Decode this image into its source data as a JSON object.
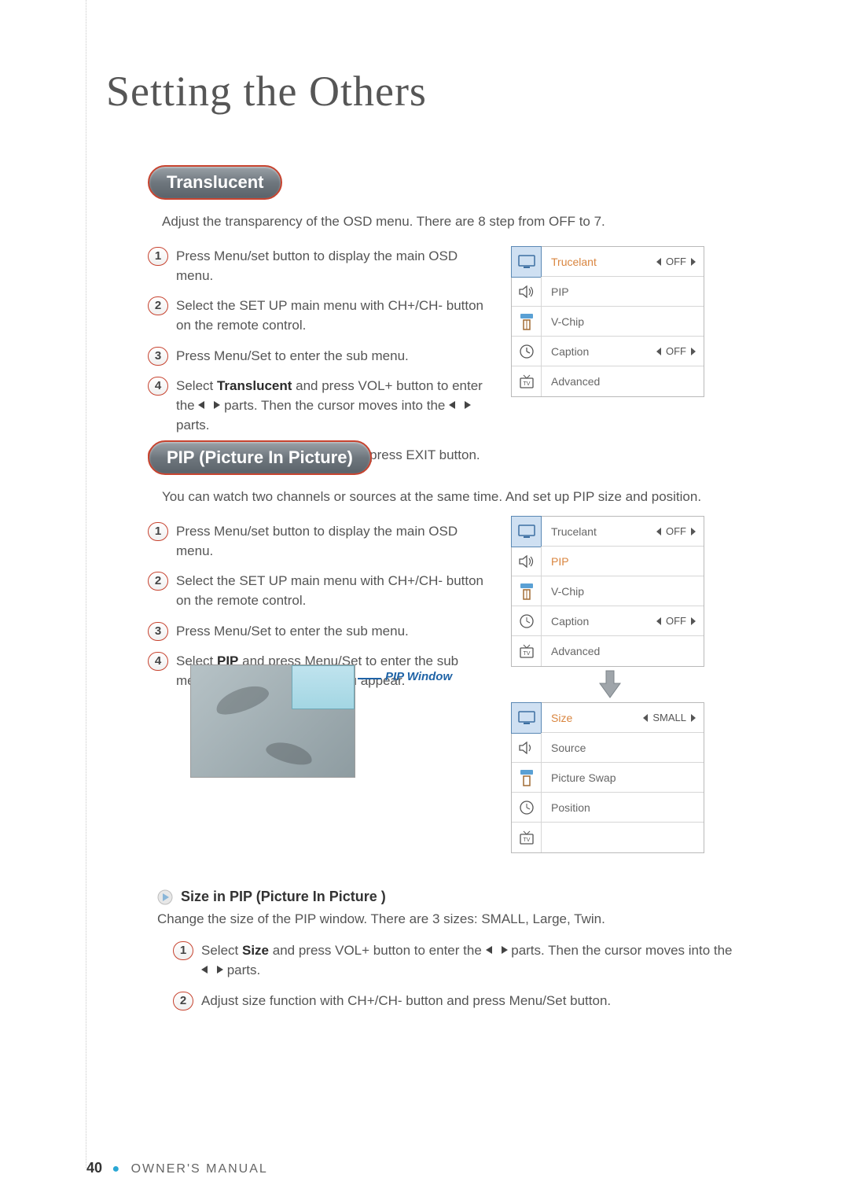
{
  "page": {
    "title": "Setting the Others",
    "number": "40",
    "footer_label": "OWNER'S MANUAL"
  },
  "sections": {
    "translucent": {
      "heading": "Translucent",
      "intro": "Adjust the transparency of the OSD menu. There are 8 step from OFF to 7.",
      "steps": [
        "Press Menu/set button to display the main OSD menu.",
        "Select the SET UP main menu with CH+/CH- button on the remote control.",
        "Press Menu/Set to enter the sub menu.",
        "Select Translucent and press VOL+ button to enter the ◀▶ parts. Then the cursor moves into the ◀▶ parts.",
        "Adjust with CH+/CH- button and press EXIT button."
      ],
      "step4_prefix": "Select ",
      "step4_bold": "Translucent",
      "step4_mid1": " and press VOL+ button to enter the ",
      "step4_mid2": " parts. Then the cursor moves into the ",
      "step4_suffix": " parts."
    },
    "pip": {
      "heading": "PIP (Picture In Picture)",
      "intro": "You can watch two channels or sources at the same time. And set up PIP size and position.",
      "steps_text": {
        "s1": "Press Menu/set button to display the main OSD menu.",
        "s2": "Select the SET UP main menu with CH+/CH- button on the remote control.",
        "s3": "Press Menu/Set to enter the sub menu.",
        "s4_prefix": "Select ",
        "s4_bold": "PIP",
        "s4_suffix": " and press Menu/Set to enter the sub menu. Then the PIP sub menu appear."
      },
      "pip_window_label": "PIP Window"
    },
    "size_in_pip": {
      "heading": "Size in PIP (Picture In Picture )",
      "intro": "Change the size of the PIP window. There are 3 sizes: SMALL, Large, Twin.",
      "s1_prefix": "Select ",
      "s1_bold": "Size",
      "s1_mid1": " and press VOL+ button to enter the ",
      "s1_mid2": " parts. Then the cursor moves into the ",
      "s1_suffix": " parts.",
      "s2": "Adjust size function with CH+/CH- button and press Menu/Set button."
    }
  },
  "osd_menu_setup": {
    "rows": [
      {
        "label": "Trucelant",
        "value": "OFF",
        "highlight": true
      },
      {
        "label": "PIP",
        "value": ""
      },
      {
        "label": "V-Chip",
        "value": ""
      },
      {
        "label": "Caption",
        "value": "OFF"
      },
      {
        "label": "Advanced",
        "value": ""
      }
    ]
  },
  "osd_menu_pipsel": {
    "rows": [
      {
        "label": "Trucelant",
        "value": "OFF"
      },
      {
        "label": "PIP",
        "value": "",
        "highlight": true
      },
      {
        "label": "V-Chip",
        "value": ""
      },
      {
        "label": "Caption",
        "value": "OFF"
      },
      {
        "label": "Advanced",
        "value": ""
      }
    ]
  },
  "osd_menu_pipsub": {
    "rows": [
      {
        "label": "Size",
        "value": "SMALL",
        "highlight": true
      },
      {
        "label": "Source",
        "value": ""
      },
      {
        "label": "Picture Swap",
        "value": ""
      },
      {
        "label": "Position",
        "value": ""
      },
      {
        "label": "",
        "value": ""
      }
    ]
  }
}
